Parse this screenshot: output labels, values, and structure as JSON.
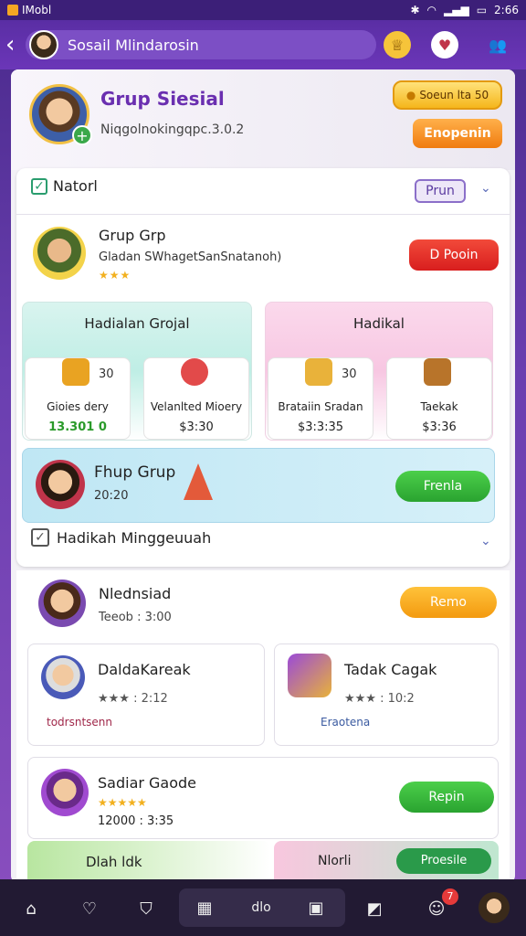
{
  "status": {
    "carrier": "IMobl",
    "time": "2:66"
  },
  "appbar": {
    "title": "Sosail Mlindarosin"
  },
  "profile": {
    "name": "Grup Siesial",
    "subtitle": "Niqgolnokingqpc.3.0.2",
    "badge_btn": "Soeun lta 50",
    "action_btn": "Enopenin"
  },
  "panel": {
    "label": "Natorl",
    "chip": "Prun"
  },
  "group": {
    "title": "Grup Grp",
    "subtitle": "Gladan SWhagetSanSnatanoh)",
    "stars": "★★★",
    "button": "D Pooin"
  },
  "banners": [
    {
      "title": "Hadialan Grojal",
      "cards": [
        {
          "num": "30",
          "name": "Gioies dery",
          "price": "13.301 0"
        },
        {
          "num": "",
          "name": "Velanlted Mioery",
          "price": "$3:30"
        }
      ]
    },
    {
      "title": "Hadikal",
      "cards": [
        {
          "num": "30",
          "name": "Brataiin Sradan",
          "price": "$3:3:35"
        },
        {
          "num": "",
          "name": "Taekak",
          "price": "$3:36"
        }
      ]
    }
  ],
  "promo": {
    "title": "Fhup Grup",
    "time": "20:20",
    "button": "Frenla"
  },
  "section2": {
    "title": "Hadikah Minggeuuah"
  },
  "user1": {
    "name": "Nlednsiad",
    "time": "Teeob : 3:00",
    "button": "Remo"
  },
  "cards2": [
    {
      "title": "DaldaKareak",
      "rating": "★★★ : 2:12",
      "meta": "todrsntsenn"
    },
    {
      "title": "Tadak Cagak",
      "rating": "★★★ : 10:2",
      "meta": "Eraotena"
    }
  ],
  "user2": {
    "name": "Sadiar Gaode",
    "stars": "★★★★★",
    "price": "12000 : 3:35",
    "button": "Repin"
  },
  "bottom_cards": [
    {
      "title": "Dlah ldk"
    },
    {
      "title": "Nlorli",
      "button": "Proesile"
    }
  ],
  "nav": {
    "center_label": "dlo",
    "badge": "7"
  },
  "colors": {
    "accent": "#6a2fb0",
    "appbar": "#5a2ea4",
    "green": "#2aa330",
    "orange": "#f39a10",
    "red": "#d81e1e"
  }
}
